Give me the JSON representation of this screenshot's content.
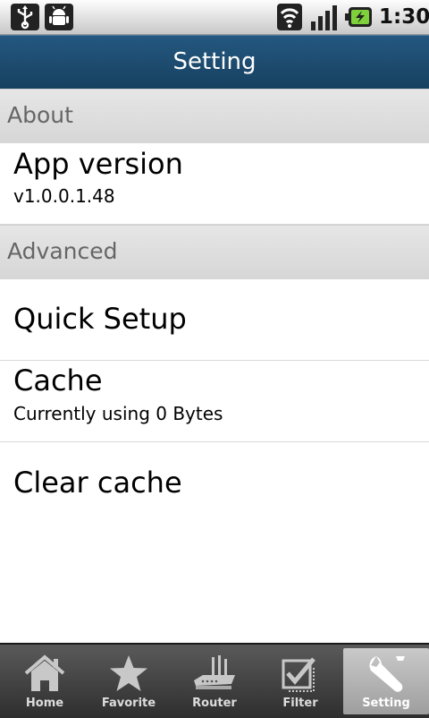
{
  "status_bar": {
    "time": "1:30",
    "icons": [
      "usb-icon",
      "android-debug-icon",
      "wifi-icon",
      "signal-icon",
      "battery-charging-icon"
    ]
  },
  "header": {
    "title": "Setting"
  },
  "sections": [
    {
      "label": "About",
      "items": [
        {
          "title": "App version",
          "subtitle": "v1.0.0.1.48"
        }
      ]
    },
    {
      "label": "Advanced",
      "items": [
        {
          "title": "Quick Setup"
        },
        {
          "title": "Cache",
          "subtitle": "Currently using 0 Bytes"
        },
        {
          "title": "Clear cache"
        }
      ]
    }
  ],
  "tabs": [
    {
      "label": "Home",
      "icon": "home-icon",
      "selected": false
    },
    {
      "label": "Favorite",
      "icon": "star-icon",
      "selected": false
    },
    {
      "label": "Router",
      "icon": "router-icon",
      "selected": false
    },
    {
      "label": "Filter",
      "icon": "filter-checkbox-icon",
      "selected": false
    },
    {
      "label": "Setting",
      "icon": "wrench-icon",
      "selected": true
    }
  ],
  "colors": {
    "title_bar": "#1d4c72",
    "tab_bar": "#3c3c3c",
    "selected_tab": "#b4b4b4",
    "section_header": "#dedede"
  }
}
